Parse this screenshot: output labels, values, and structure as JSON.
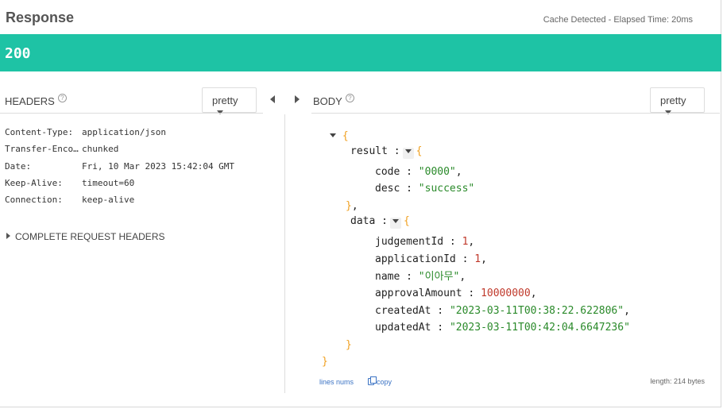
{
  "response": {
    "title": "Response",
    "meta": "Cache Detected - Elapsed Time: 20ms",
    "status_code": "200"
  },
  "headers_panel": {
    "title": "HEADERS",
    "help": "?",
    "format": "pretty",
    "rows": [
      {
        "key": "Content-Type:",
        "value": "application/json"
      },
      {
        "key": "Transfer-Encoding:",
        "value": "chunked"
      },
      {
        "key": "Date:",
        "value": "Fri, 10 Mar 2023 15:42:04 GMT"
      },
      {
        "key": "Keep-Alive:",
        "value": "timeout=60"
      },
      {
        "key": "Connection:",
        "value": "keep-alive"
      }
    ],
    "complete_request": "COMPLETE REQUEST HEADERS"
  },
  "body_panel": {
    "title": "BODY",
    "help": "?",
    "format": "pretty",
    "json": {
      "result_key": "result",
      "code_key": "code",
      "code_value": "\"0000\"",
      "desc_key": "desc",
      "desc_value": "\"success\"",
      "data_key": "data",
      "judgementId_key": "judgementId",
      "judgementId_value": "1",
      "applicationId_key": "applicationId",
      "applicationId_value": "1",
      "name_key": "name",
      "name_value": "\"이아무\"",
      "approvalAmount_key": "approvalAmount",
      "approvalAmount_value": "10000000",
      "createdAt_key": "createdAt",
      "createdAt_value": "\"2023-03-11T00:38:22.622806\"",
      "updatedAt_key": "updatedAt",
      "updatedAt_value": "\"2023-03-11T00:42:04.6647236\""
    },
    "lines_nums": "lines nums",
    "copy": "copy",
    "length": "length: 214 bytes"
  },
  "colors": {
    "status_bar": "#1ec3a5",
    "brace": "#f0a020",
    "string": "#2a8a2a",
    "number": "#c0392b",
    "link": "#3b73c4"
  }
}
